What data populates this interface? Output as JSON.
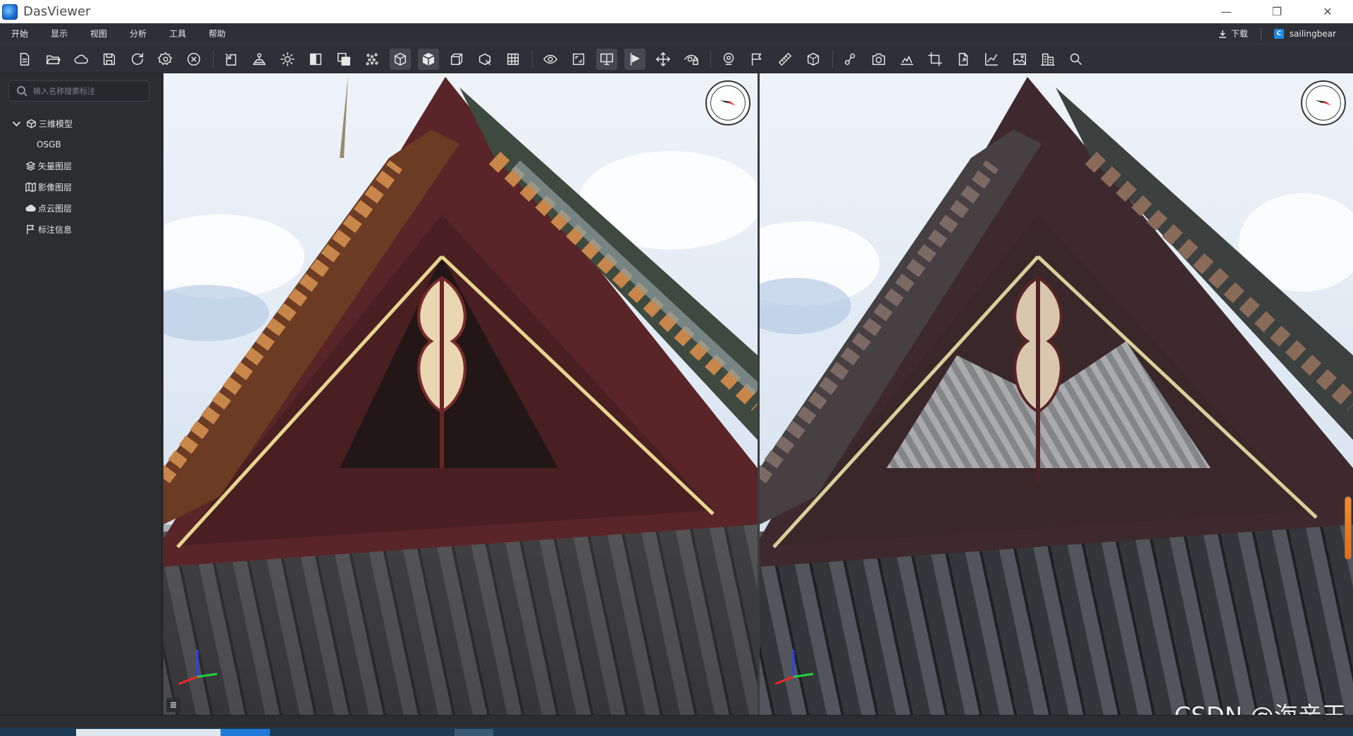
{
  "window": {
    "title": "DasViewer",
    "minimize": "—",
    "restore": "❐",
    "close": "✕"
  },
  "menu": [
    "开始",
    "显示",
    "视图",
    "分析",
    "工具",
    "帮助"
  ],
  "menu_right": {
    "download_label": "下载",
    "username": "sailingbear",
    "user_logo_letter": "C"
  },
  "toolbar_icons": [
    "new-file-icon",
    "open-folder-icon",
    "cloud-icon",
    "save-icon",
    "refresh-icon",
    "settings-icon",
    "close-circle-icon",
    "import-icon",
    "terrain-icon",
    "light-icon",
    "split-view-icon",
    "overlay-icon",
    "points-icon",
    "box-outline-icon",
    "box-solid-icon",
    "box-wire-icon",
    "box-clip-icon",
    "grid-icon",
    "eye-rotate-icon",
    "frame-icon",
    "monitor-icon",
    "flag-play-icon",
    "move-icon",
    "eye-lock-icon",
    "location-icon",
    "flag-icon",
    "ruler-icon",
    "volume-icon",
    "route-icon",
    "camera-icon",
    "profile-icon",
    "crop-icon",
    "export-icon",
    "chart-export-icon",
    "image-icon",
    "building-icon",
    "search-icon"
  ],
  "toolbar_active": [
    13,
    14,
    20,
    21
  ],
  "sidebar": {
    "search_placeholder": "输入名称搜索标注",
    "tree": [
      {
        "label": "三维模型",
        "icon": "cube-icon",
        "expanded": true,
        "level": 0
      },
      {
        "label": "OSGB",
        "icon": "",
        "level": 1
      },
      {
        "label": "矢量图层",
        "icon": "layers-icon",
        "level": 0
      },
      {
        "label": "影像图层",
        "icon": "map-icon",
        "level": 0
      },
      {
        "label": "点云图层",
        "icon": "cloud-points-icon",
        "level": 0
      },
      {
        "label": "标注信息",
        "icon": "flag-icon",
        "level": 0
      }
    ]
  },
  "watermark": "CSDN @海亲王",
  "colors": {
    "accent": "#1e88e5",
    "background": "#2b2d31",
    "scroll_thumb": "#f08224"
  }
}
